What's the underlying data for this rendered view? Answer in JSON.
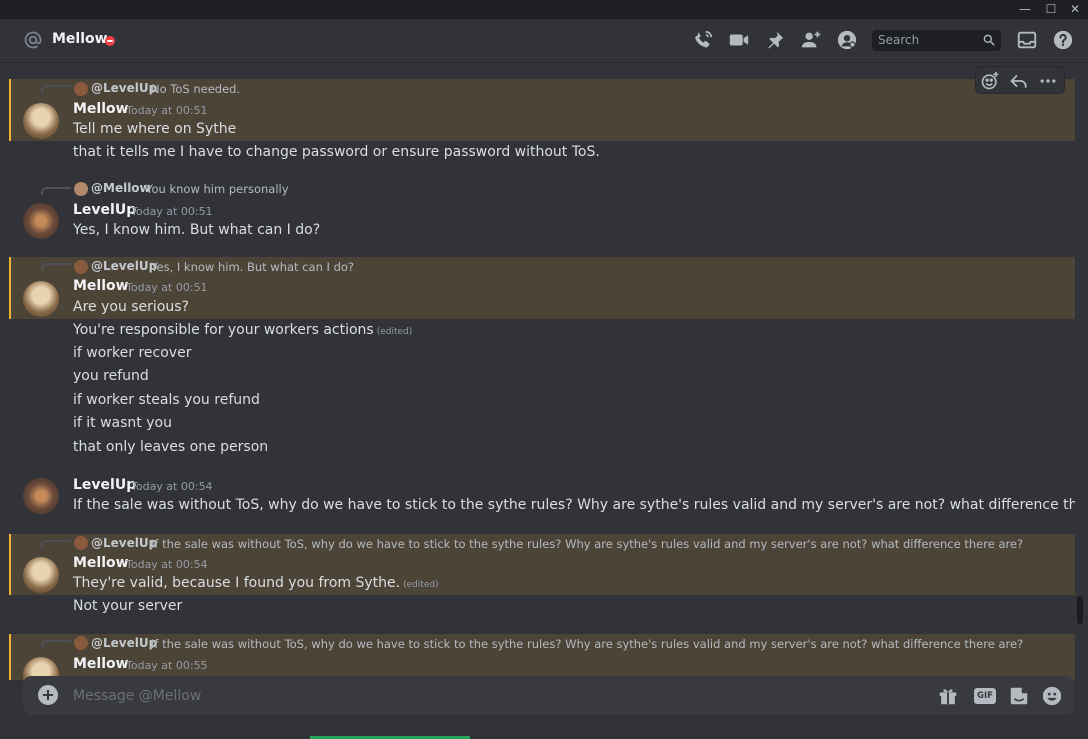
{
  "window": {
    "min_glyph": "—",
    "max_glyph": "☐",
    "close_glyph": "✕"
  },
  "header": {
    "channel_name": "Mellow",
    "search_placeholder": "Search",
    "icons": [
      "call-icon",
      "video-icon",
      "pin-icon",
      "add-friend-icon",
      "profile-icon",
      "inbox-icon",
      "help-icon"
    ]
  },
  "messages": [
    {
      "reply": {
        "author": "@LevelUp",
        "text": "No ToS needed."
      },
      "author": "Mellow",
      "timestamp": "Today at 00:51",
      "lines": [
        "Tell me where on Sythe"
      ]
    },
    {
      "continuation": true,
      "lines": [
        "that it tells me I have to change password or ensure password without ToS."
      ]
    },
    {
      "reply": {
        "author": "@Mellow",
        "text": "You know him personally"
      },
      "author": "LevelUp",
      "timestamp": "Today at 00:51",
      "lines": [
        "Yes, I know him. But what can I do?"
      ]
    },
    {
      "reply": {
        "author": "@LevelUp",
        "text": "Yes, I know him. But what can I do?"
      },
      "author": "Mellow",
      "timestamp": "Today at 00:51",
      "lines": [
        "Are you serious?"
      ]
    },
    {
      "continuation": true,
      "lines": [
        "You're responsible for your workers actions",
        "if worker recover",
        "you refund",
        "if worker steals you refund",
        "if it wasnt you",
        "that only leaves one person"
      ],
      "edited_label": "(edited)"
    },
    {
      "author": "LevelUp",
      "timestamp": "Today at 00:54",
      "lines": [
        "If the sale was without ToS, why do we have to stick to the sythe rules? Why are sythe's rules valid and my server's are not? what difference there are?"
      ]
    },
    {
      "reply": {
        "author": "@LevelUp",
        "text": "If the sale was without ToS, why do we have to stick to the sythe rules? Why are sythe's rules valid and my server's are not? what difference there are?"
      },
      "author": "Mellow",
      "timestamp": "Today at 00:54",
      "lines": [
        "They're valid, because I found you from Sythe."
      ],
      "edited_label": "(edited)"
    },
    {
      "continuation": true,
      "lines": [
        "Not your server"
      ]
    },
    {
      "reply": {
        "author": "@LevelUp",
        "text": "If the sale was without ToS, why do we have to stick to the sythe rules? Why are sythe's rules valid and my server's are not? what difference there are?"
      },
      "author": "Mellow",
      "timestamp": "Today at 00:55"
    }
  ],
  "composer": {
    "placeholder": "Message @Mellow",
    "gif_label": "GIF"
  },
  "colors": {
    "mention_bg": "#4a4233",
    "mention_bar": "#f0b232",
    "dnd": "#f23f43",
    "bg": "#313338"
  }
}
